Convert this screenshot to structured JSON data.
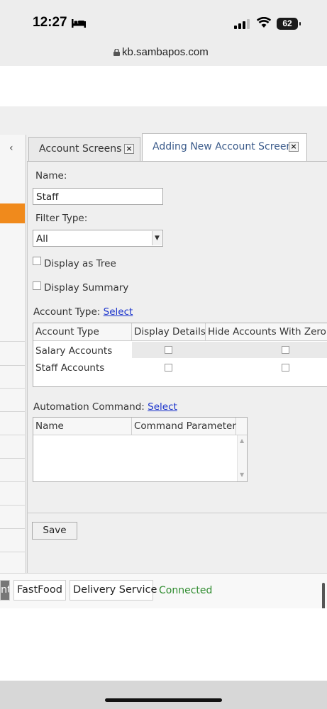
{
  "status_bar": {
    "time": "12:27",
    "battery": "62"
  },
  "browser": {
    "url": "kb.sambapos.com"
  },
  "left_panel": {
    "collapse_glyph": "‹"
  },
  "tabs": [
    {
      "label": "Account Screens",
      "close": "×"
    },
    {
      "label": "Adding New Account Screen",
      "close": "×"
    }
  ],
  "form": {
    "name_label": "Name:",
    "name_value": "Staff",
    "filter_type_label": "Filter Type:",
    "filter_type_value": "All",
    "display_as_tree": {
      "label": "Display as Tree",
      "checked": false
    },
    "display_summary": {
      "label": "Display Summary",
      "checked": false
    },
    "account_type_label": "Account Type:",
    "account_type_link": "Select",
    "account_types_grid": {
      "columns": [
        "Account Type",
        "Display Details",
        "Hide Accounts With Zero B"
      ],
      "rows": [
        {
          "name": "Salary Accounts",
          "display_details": false,
          "hide_zero": false
        },
        {
          "name": "Staff Accounts",
          "display_details": false,
          "hide_zero": false
        }
      ]
    },
    "automation_command_label": "Automation Command:",
    "automation_command_link": "Select",
    "automation_grid": {
      "columns": [
        "Name",
        "Command Parameter"
      ]
    },
    "save_label": "Save"
  },
  "bottom_bar": {
    "first_btn": "nt",
    "fastfood": "FastFood",
    "delivery": "Delivery Service",
    "status": "Connected"
  },
  "colors": {
    "accent_orange": "#f08a1c",
    "connected_green": "#2e8b2e",
    "link_blue": "#1a33cc"
  },
  "icons": [
    "bed-icon",
    "signal-icon",
    "wifi-icon",
    "lock-icon",
    "close-icon",
    "chevron-down-icon"
  ]
}
